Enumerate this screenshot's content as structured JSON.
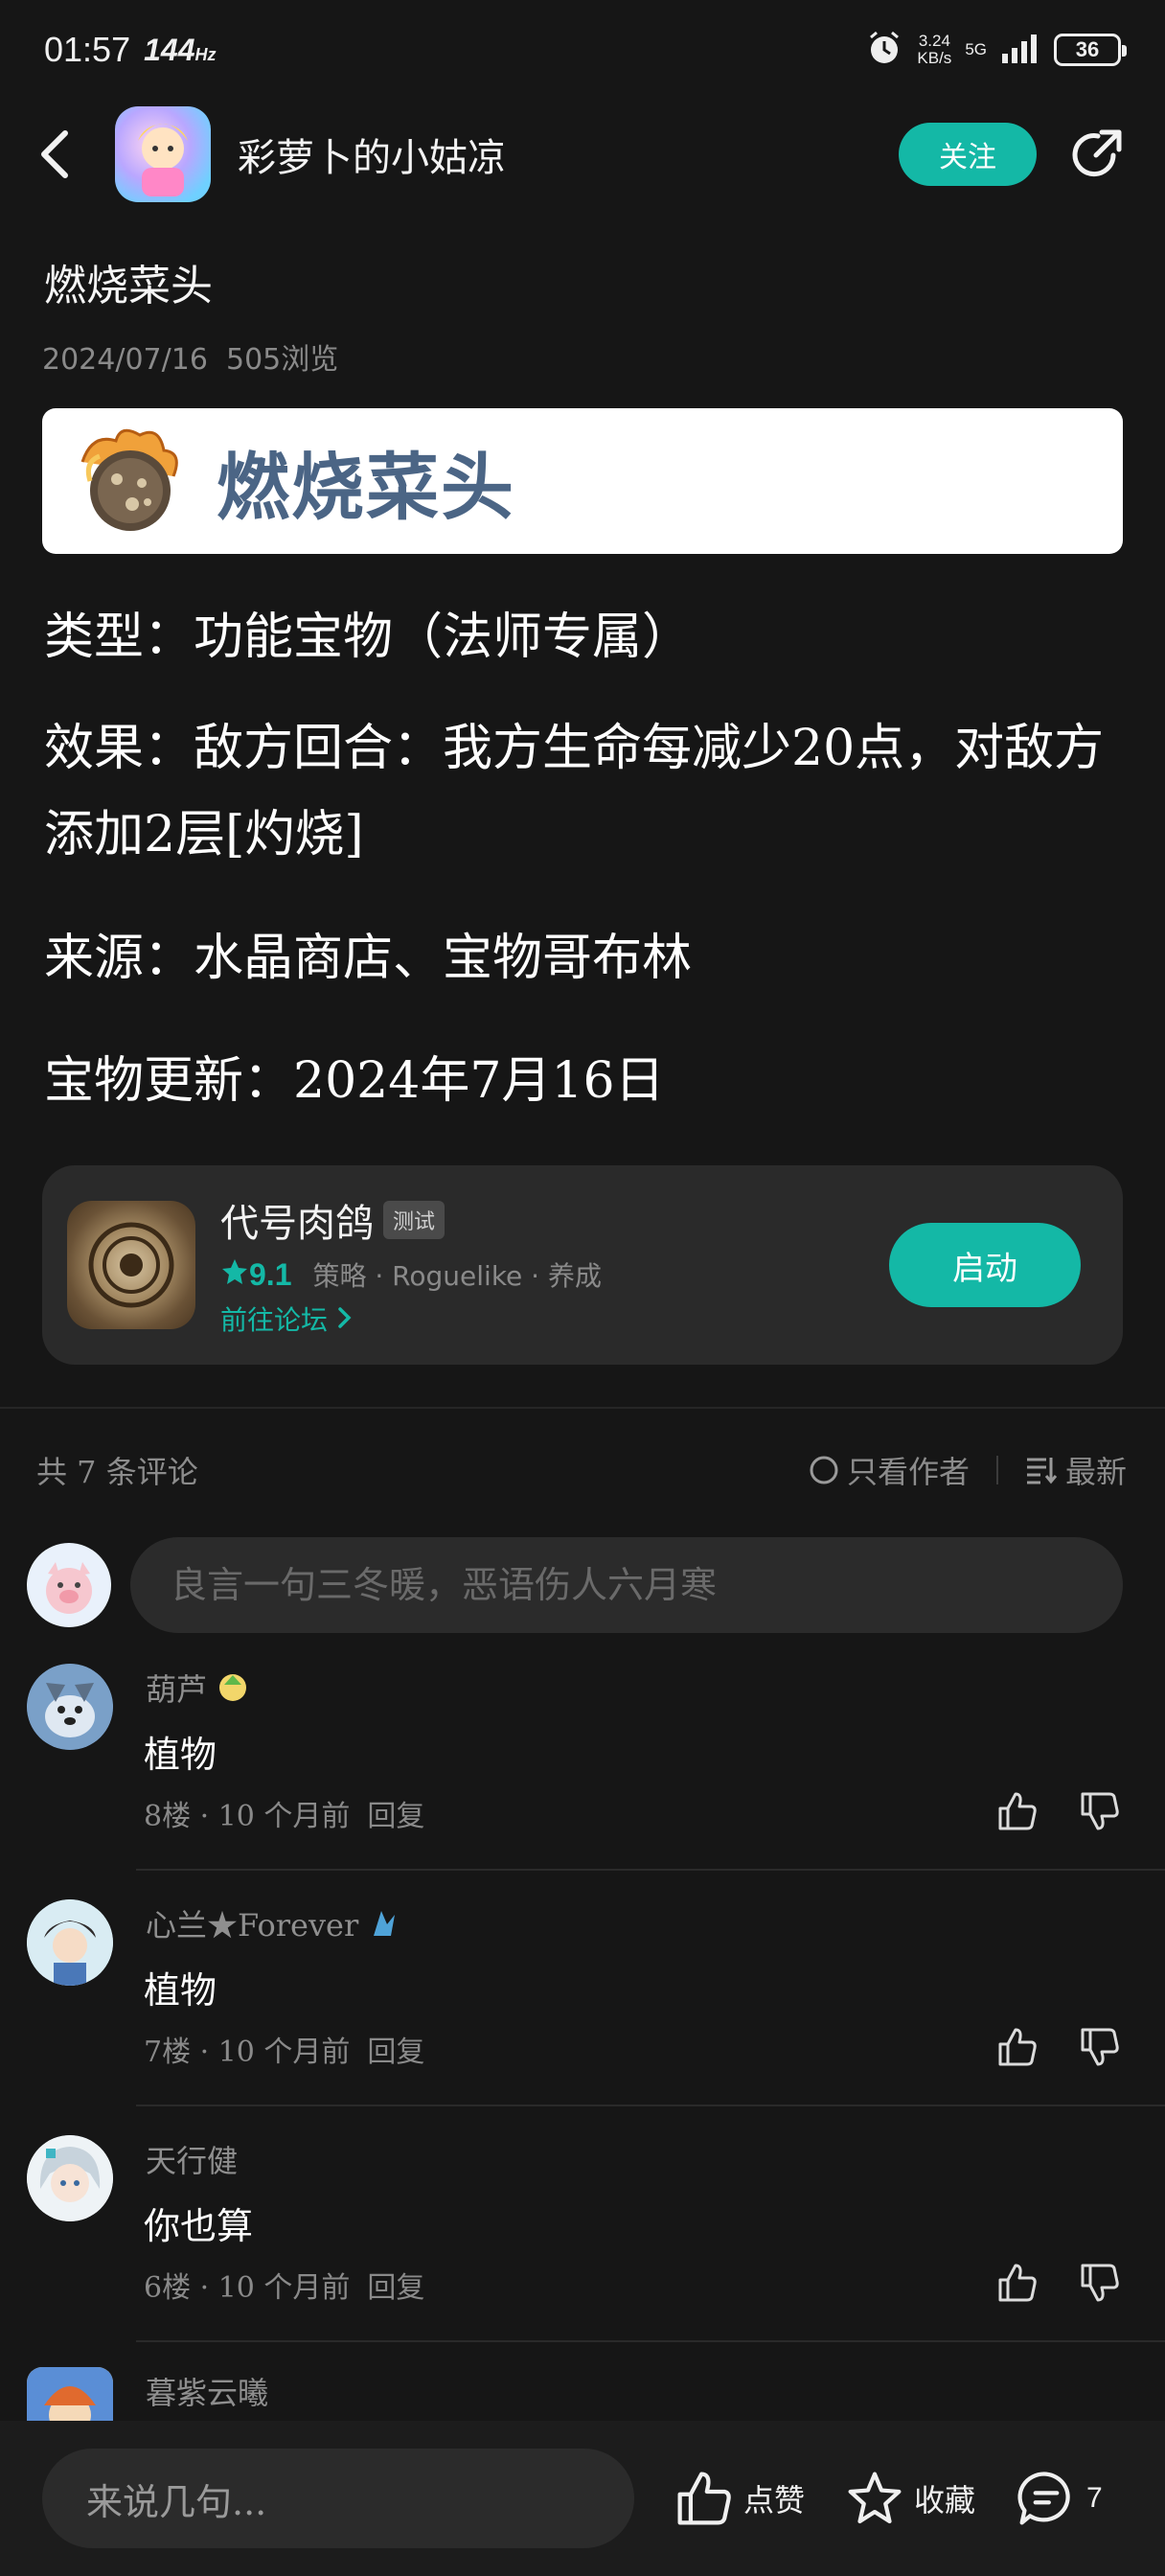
{
  "status_bar": {
    "time": "01:57",
    "refresh_rate": "144",
    "refresh_unit": "Hz",
    "net_speed_value": "3.24",
    "net_speed_unit": "KB/s",
    "network": "5G",
    "battery": "36"
  },
  "header": {
    "author_name": "彩萝卜的小姑凉",
    "follow_label": "关注"
  },
  "post": {
    "title": "燃烧菜头",
    "date": "2024/07/16",
    "views": "505浏览",
    "banner_text": "燃烧菜头",
    "paragraphs": [
      "类型：功能宝物（法师专属）",
      "效果：敌方回合：我方生命每减少20点，对敌方添加2层[灼烧]",
      "来源：水晶商店、宝物哥布林",
      "宝物更新：2024年7月16日"
    ]
  },
  "game_card": {
    "name": "代号肉鸽",
    "tag": "测试",
    "rating": "9.1",
    "genres": "策略 · Roguelike · 养成",
    "forum_link": "前往论坛",
    "launch_label": "启动"
  },
  "comments_header": {
    "count_text": "共 7 条评论",
    "only_author": "只看作者",
    "sort": "最新"
  },
  "comment_input": {
    "placeholder": "良言一句三冬暖，恶语伤人六月寒"
  },
  "comments": [
    {
      "name": "葫芦",
      "text": "植物",
      "floor": "8楼 · 10 个月前",
      "reply": "回复"
    },
    {
      "name": "心兰★Forever",
      "text": "植物",
      "floor": "7楼 · 10 个月前",
      "reply": "回复"
    },
    {
      "name": "天行健",
      "text": "你也算",
      "floor": "6楼 · 10 个月前",
      "reply": "回复"
    },
    {
      "name": "暮紫云曦",
      "text": "",
      "floor": "",
      "reply": ""
    }
  ],
  "bottom_bar": {
    "input_placeholder": "来说几句...",
    "like_label": "点赞",
    "favorite_label": "收藏",
    "comment_count": "7"
  },
  "colors": {
    "accent": "#14b8a6",
    "background": "#161616",
    "card": "#2a2a2a"
  }
}
